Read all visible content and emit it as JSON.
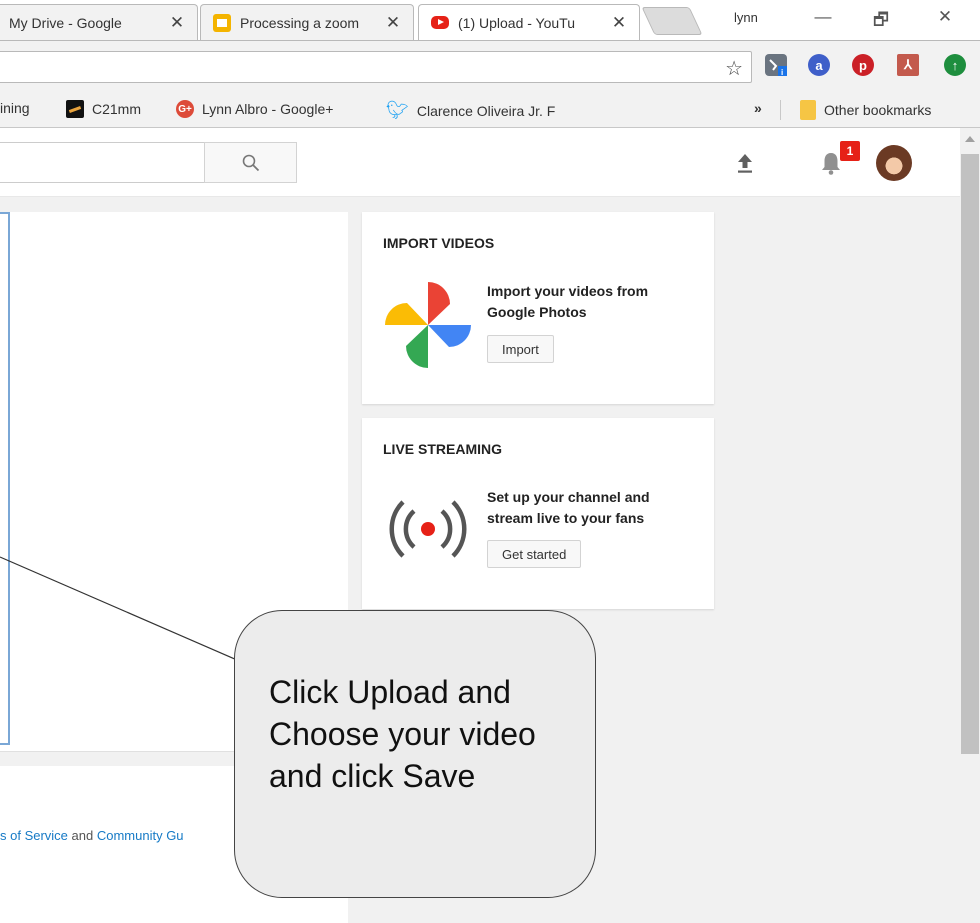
{
  "browser": {
    "tabs": [
      {
        "title": "My Drive - Google",
        "favicon": "drive-icon",
        "active": false
      },
      {
        "title": "Processing a zoom",
        "favicon": "slides-icon",
        "active": false
      },
      {
        "title": "(1) Upload - YouTu",
        "favicon": "youtube-icon",
        "active": true
      }
    ],
    "close_glyph": "✕",
    "profile_name": "lynn",
    "window_controls": [
      "—",
      "🗗",
      "✕"
    ],
    "bookmark_star": "☆",
    "extensions": [
      {
        "name": "extension-icon",
        "color": "#5f6b7a"
      },
      {
        "name": "amazon-assistant-icon",
        "color": "#3f5fc9",
        "glyph": "a"
      },
      {
        "name": "pinterest-icon",
        "color": "#cb2027",
        "glyph": "p"
      },
      {
        "name": "pdf-icon",
        "color": "#c35a4d",
        "glyph": "⅄"
      },
      {
        "name": "update-icon",
        "color": "#1e8e3e",
        "glyph": "↑"
      }
    ],
    "bookmarks": [
      {
        "label": "ining",
        "icon": "none"
      },
      {
        "label": "C21mm",
        "icon": "c21-icon"
      },
      {
        "label": "Lynn Albro - Google+",
        "icon": "google-plus-icon"
      },
      {
        "label": "Clarence Oliveira Jr. F",
        "icon": "twitter-icon"
      }
    ],
    "bookmarks_overflow": "»",
    "other_bookmarks": "Other bookmarks"
  },
  "youtube": {
    "notification_count": "1",
    "import_card": {
      "title": "IMPORT VIDEOS",
      "text": "Import your videos from Google Photos",
      "button": "Import"
    },
    "live_card": {
      "title": "LIVE STREAMING",
      "text": "Set up your channel and stream live to your fans",
      "button": "Get started"
    },
    "footer": {
      "prefix": "s of Service",
      "middle": " and ",
      "link": "Community Gu"
    }
  },
  "callout": {
    "text": "Click Upload and Choose your video and click Save"
  },
  "colors": {
    "youtube_red": "#e62117",
    "link_blue": "#167ac6",
    "twitter_blue": "#1da1f2"
  }
}
